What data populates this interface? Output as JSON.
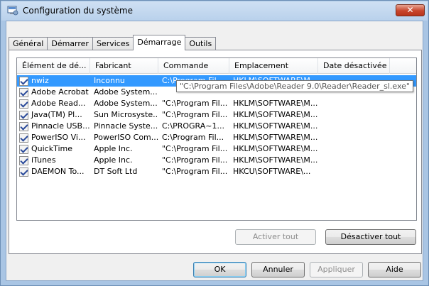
{
  "window": {
    "title": "Configuration du système",
    "close_label": "✕"
  },
  "tabs": [
    {
      "label": "Général",
      "active": false
    },
    {
      "label": "Démarrer",
      "active": false
    },
    {
      "label": "Services",
      "active": false
    },
    {
      "label": "Démarrage",
      "active": true
    },
    {
      "label": "Outils",
      "active": false
    }
  ],
  "table": {
    "columns": [
      "Élément de dé...",
      "Fabricant",
      "Commande",
      "Emplacement",
      "Date désactivée"
    ],
    "rows": [
      {
        "checked": true,
        "selected": true,
        "cells": [
          "nwiz",
          "Inconnu",
          "C:\\Program Fil...",
          "HKLM\\SOFTWARE\\M...",
          ""
        ]
      },
      {
        "checked": true,
        "selected": false,
        "cells": [
          "Adobe Acrobat",
          "Adobe System...",
          "",
          "",
          ""
        ]
      },
      {
        "checked": true,
        "selected": false,
        "cells": [
          "Adobe Read...",
          "Adobe System...",
          "\"C:\\Program Fil...",
          "HKLM\\SOFTWARE\\M...",
          ""
        ]
      },
      {
        "checked": true,
        "selected": false,
        "cells": [
          "Java(TM) Pl...",
          "Sun Microsyste...",
          "\"C:\\Program Fil...",
          "HKLM\\SOFTWARE\\M...",
          ""
        ]
      },
      {
        "checked": true,
        "selected": false,
        "cells": [
          "Pinnacle USB...",
          "Pinnacle Syste...",
          "C:\\PROGRA~1...",
          "HKLM\\SOFTWARE\\M...",
          ""
        ]
      },
      {
        "checked": true,
        "selected": false,
        "cells": [
          "PowerISO Vi...",
          "PowerISO Com...",
          "C:\\Program Fil...",
          "HKLM\\SOFTWARE\\M...",
          ""
        ]
      },
      {
        "checked": true,
        "selected": false,
        "cells": [
          "QuickTime",
          "Apple Inc.",
          "\"C:\\Program Fil...",
          "HKLM\\SOFTWARE\\M...",
          ""
        ]
      },
      {
        "checked": true,
        "selected": false,
        "cells": [
          "iTunes",
          "Apple Inc.",
          "\"C:\\Program Fil...",
          "HKLM\\SOFTWARE\\M...",
          ""
        ]
      },
      {
        "checked": true,
        "selected": false,
        "cells": [
          "DAEMON To...",
          "DT Soft Ltd",
          "\"C:\\Program Fil...",
          "HKCU\\SOFTWARE\\...",
          ""
        ]
      }
    ],
    "tooltip": "\"C:\\Program Files\\Adobe\\Reader 9.0\\Reader\\Reader_sl.exe\""
  },
  "panel_buttons": {
    "enable_all": "Activer tout",
    "disable_all": "Désactiver tout"
  },
  "dialog_buttons": {
    "ok": "OK",
    "cancel": "Annuler",
    "apply": "Appliquer",
    "help": "Aide"
  }
}
